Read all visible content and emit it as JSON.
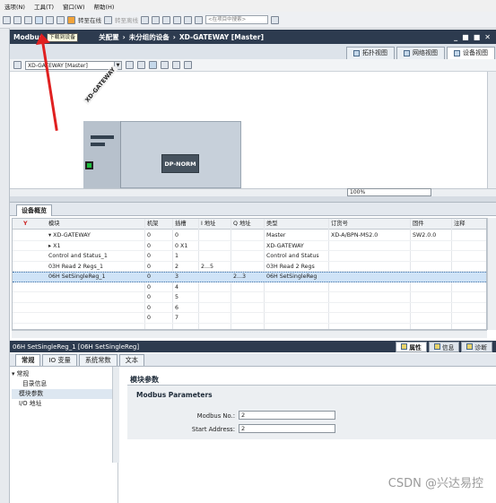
{
  "menu": [
    "选项(N)",
    "工具(T)",
    "窗口(W)",
    "帮助(H)"
  ],
  "toolbar": {
    "go_online": "转至在线",
    "go_offline": "转至离线",
    "search_placeholder": "<在项目中搜索>"
  },
  "title": {
    "prefix": "Modbus",
    "suffix": "关配置",
    "sep1": "›",
    "group": "未分组的设备",
    "sep2": "›",
    "device": "XD-GATEWAY [Master]",
    "win_buttons": [
      "_",
      "■",
      "■",
      "✕"
    ]
  },
  "tooltip": "下载到设备",
  "view_tabs": [
    {
      "label": "拓扑视图",
      "active": false
    },
    {
      "label": "网络视图",
      "active": false
    },
    {
      "label": "设备视图",
      "active": true
    }
  ],
  "device_select": "XD-GATEWAY [Master]",
  "canvas": {
    "station_label": "XD-GATEWAY",
    "module_label": "DP-NORM"
  },
  "zoom": "100%",
  "overview_tab": "设备概览",
  "grid": {
    "columns": [
      "模块",
      "机架",
      "插槽",
      "I 地址",
      "Q 地址",
      "类型",
      "订货号",
      "固件",
      "注释"
    ],
    "rows": [
      {
        "module": "▾  XD-GATEWAY",
        "rack": "0",
        "slot": "0",
        "i": "",
        "q": "",
        "type": "Master",
        "order": "XD-A/BPN-MS2.0",
        "fw": "SW2.0.0",
        "selected": false
      },
      {
        "module": "   ▸  X1",
        "rack": "0",
        "slot": "0 X1",
        "i": "",
        "q": "",
        "type": "XD-GATEWAY",
        "order": "",
        "fw": "",
        "selected": false
      },
      {
        "module": "Control and Status_1",
        "rack": "0",
        "slot": "1",
        "i": "",
        "q": "",
        "type": "Control and Status",
        "order": "",
        "fw": "",
        "selected": false
      },
      {
        "module": "03H Read 2 Regs_1",
        "rack": "0",
        "slot": "2",
        "i": "2...5",
        "q": "",
        "type": "03H Read 2 Regs",
        "order": "",
        "fw": "",
        "selected": false
      },
      {
        "module": "06H SetSingleReg_1",
        "rack": "0",
        "slot": "3",
        "i": "",
        "q": "2...3",
        "type": "06H SetSingleReg",
        "order": "",
        "fw": "",
        "selected": true
      },
      {
        "module": "",
        "rack": "0",
        "slot": "4",
        "i": "",
        "q": "",
        "type": "",
        "order": "",
        "fw": "",
        "selected": false
      },
      {
        "module": "",
        "rack": "0",
        "slot": "5",
        "i": "",
        "q": "",
        "type": "",
        "order": "",
        "fw": "",
        "selected": false
      },
      {
        "module": "",
        "rack": "0",
        "slot": "6",
        "i": "",
        "q": "",
        "type": "",
        "order": "",
        "fw": "",
        "selected": false
      },
      {
        "module": "",
        "rack": "0",
        "slot": "7",
        "i": "",
        "q": "",
        "type": "",
        "order": "",
        "fw": "",
        "selected": false
      }
    ]
  },
  "properties": {
    "title": "06H SetSingleReg_1 [06H SetSingleReg]",
    "tabs": [
      {
        "label": "属性",
        "active": true
      },
      {
        "label": "信息",
        "active": false
      },
      {
        "label": "诊断",
        "active": false
      }
    ],
    "subtabs": [
      {
        "label": "常规",
        "active": true
      },
      {
        "label": "IO 变量",
        "active": false
      },
      {
        "label": "系统常数",
        "active": false
      },
      {
        "label": "文本",
        "active": false
      }
    ],
    "nav": [
      {
        "label": "▾ 常规",
        "cls": ""
      },
      {
        "label": "目录信息",
        "cls": "indent"
      },
      {
        "label": "模块参数",
        "cls": "sub sel"
      },
      {
        "label": "I/O 地址",
        "cls": "sub"
      }
    ],
    "section_title": "模块参数",
    "params_title": "Modbus Parameters",
    "fields": [
      {
        "label": "Modbus No.:",
        "value": "2"
      },
      {
        "label": "Start Address:",
        "value": "2"
      }
    ]
  },
  "watermark": "CSDN @兴达易控"
}
